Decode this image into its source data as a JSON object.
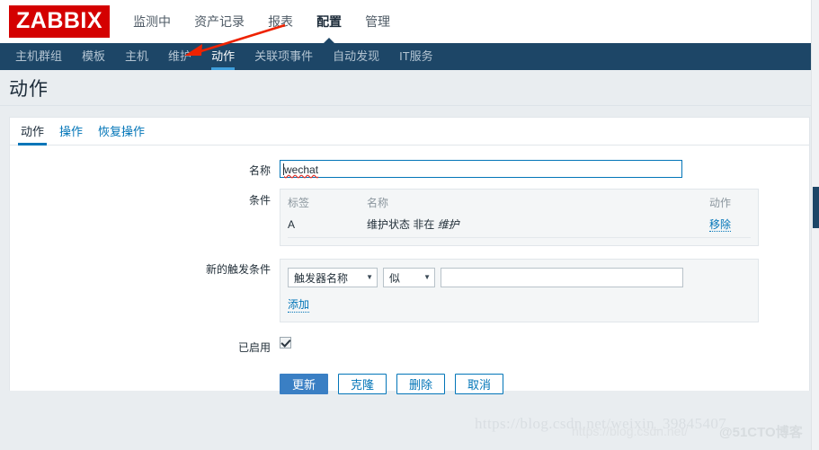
{
  "brand": {
    "logo_text": "ZABBIX"
  },
  "main_menu": {
    "items": [
      {
        "label": "监测中",
        "active": false
      },
      {
        "label": "资产记录",
        "active": false
      },
      {
        "label": "报表",
        "active": false
      },
      {
        "label": "配置",
        "active": true
      },
      {
        "label": "管理",
        "active": false
      }
    ]
  },
  "sub_menu": {
    "items": [
      {
        "label": "主机群组",
        "active": false
      },
      {
        "label": "模板",
        "active": false
      },
      {
        "label": "主机",
        "active": false
      },
      {
        "label": "维护",
        "active": false
      },
      {
        "label": "动作",
        "active": true
      },
      {
        "label": "关联项事件",
        "active": false
      },
      {
        "label": "自动发现",
        "active": false
      },
      {
        "label": "IT服务",
        "active": false
      }
    ]
  },
  "page": {
    "title": "动作"
  },
  "tabs": [
    {
      "label": "动作",
      "active": true
    },
    {
      "label": "操作",
      "active": false
    },
    {
      "label": "恢复操作",
      "active": false
    }
  ],
  "form": {
    "name": {
      "label": "名称",
      "value": "wechat",
      "placeholder": ""
    },
    "conditions": {
      "label": "条件",
      "headers": {
        "label_col": "标签",
        "name_col": "名称",
        "action_col": "动作"
      },
      "rows": [
        {
          "label": "A",
          "name_prefix": "维护状态 非在 ",
          "name_italic": "维护",
          "action": "移除"
        }
      ]
    },
    "new_condition": {
      "label": "新的触发条件",
      "type_select": "触发器名称",
      "operator_select": "似",
      "value_input": "",
      "value_placeholder": "",
      "add_link": "添加"
    },
    "enabled": {
      "label": "已启用",
      "checked": true
    },
    "buttons": [
      {
        "label": "更新",
        "style": "primary"
      },
      {
        "label": "克隆",
        "style": "default"
      },
      {
        "label": "删除",
        "style": "default"
      },
      {
        "label": "取消",
        "style": "default"
      }
    ]
  },
  "watermarks": {
    "url_large": "https://blog.csdn.net/weixin_39845407",
    "url_small": "https://blog.csdn.net/",
    "site": "@51CTO博客"
  },
  "colors": {
    "brand_red": "#d40000",
    "nav_dark": "#1d4667",
    "accent_blue": "#0275b8",
    "primary_button": "#3a7fc4",
    "page_bg": "#e9edf0"
  }
}
